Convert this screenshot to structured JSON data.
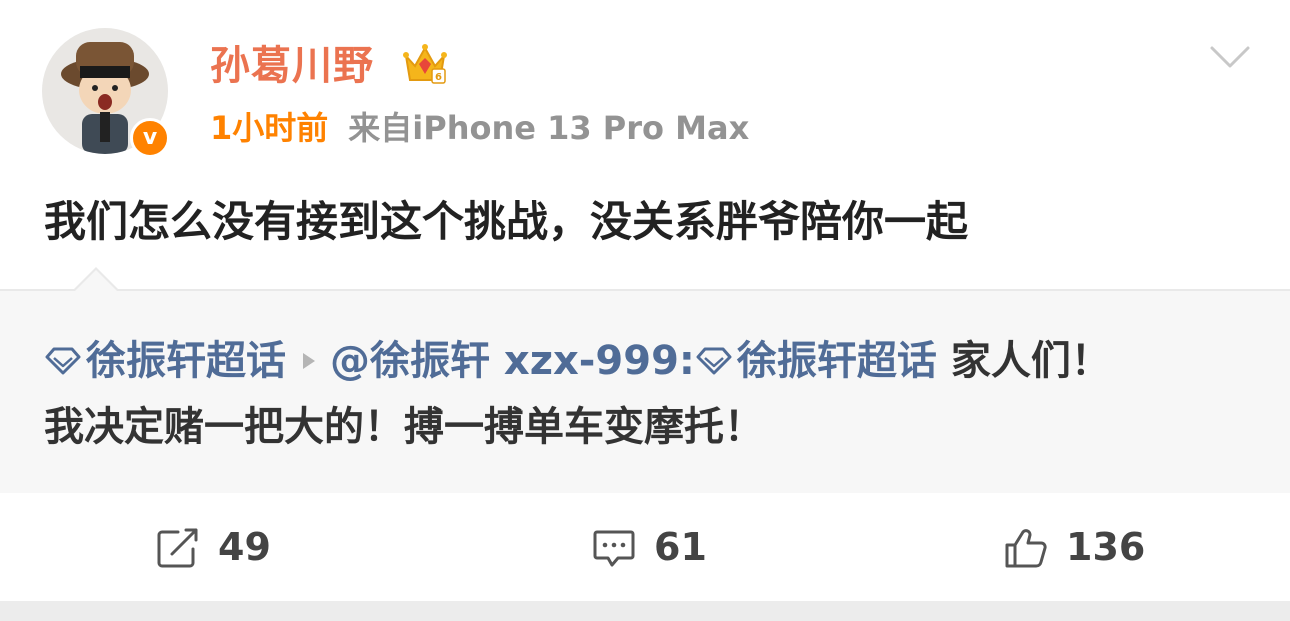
{
  "post": {
    "username": "孙葛川野",
    "time": "1小时前",
    "source": "来自iPhone 13 Pro Max",
    "text": "我们怎么没有接到这个挑战，没关系胖爷陪你一起"
  },
  "repost": {
    "topic1": "徐振轩超话",
    "author": "@徐振轩 xzx-999:",
    "topic2": "徐振轩超话",
    "text_line1_end": " 家人们！",
    "text_line2": "我决定赌一把大的！搏一搏单车变摩托！"
  },
  "actions": {
    "repost_count": "49",
    "comment_count": "61",
    "like_count": "136"
  },
  "colors": {
    "username": "#eb7350",
    "time": "#ff8200",
    "link": "#506c97",
    "verified_badge": "#ff8200"
  },
  "icons": [
    "avatar",
    "verified-v-icon",
    "crown-icon",
    "chevron-down-icon",
    "diamond-icon",
    "play-arrow-icon",
    "repost-icon",
    "comment-icon",
    "like-icon"
  ]
}
